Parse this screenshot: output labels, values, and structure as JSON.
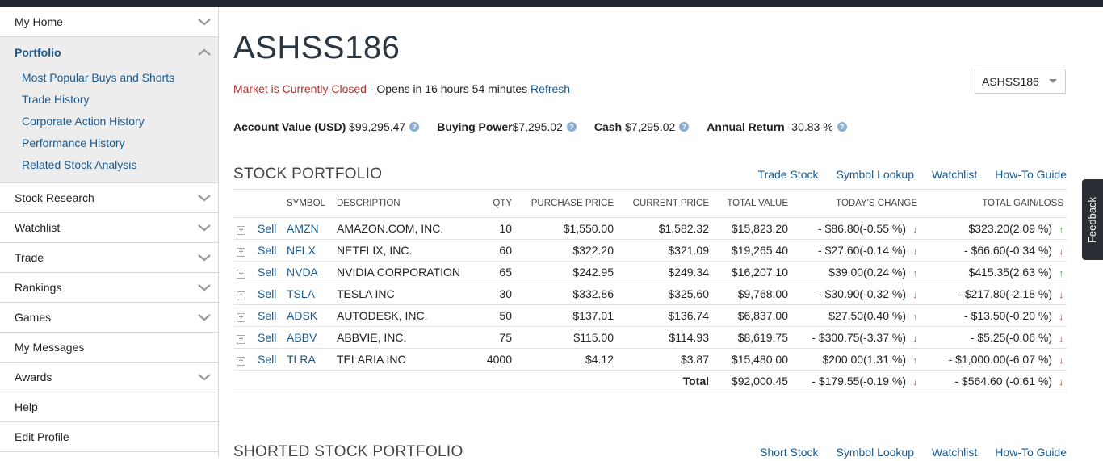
{
  "sidebar": {
    "items": [
      {
        "label": "My Home",
        "chevron": "down"
      },
      {
        "label": "Portfolio",
        "chevron": "up",
        "active": true,
        "children": [
          "Most Popular Buys and Shorts",
          "Trade History",
          "Corporate Action History",
          "Performance History",
          "Related Stock Analysis"
        ]
      },
      {
        "label": "Stock Research",
        "chevron": "down"
      },
      {
        "label": "Watchlist",
        "chevron": "down"
      },
      {
        "label": "Trade",
        "chevron": "down"
      },
      {
        "label": "Rankings",
        "chevron": "down"
      },
      {
        "label": "Games",
        "chevron": "down"
      },
      {
        "label": "My Messages",
        "chevron": ""
      },
      {
        "label": "Awards",
        "chevron": "down"
      },
      {
        "label": "Help",
        "chevron": ""
      },
      {
        "label": "Edit Profile",
        "chevron": ""
      }
    ]
  },
  "header": {
    "title": "ASHSS186",
    "market_status": "Market is Currently Closed",
    "market_opens": " - Opens in 16 hours 54 minutes ",
    "refresh": "Refresh",
    "account_select": "ASHSS186"
  },
  "stats": {
    "account_value_label": "Account Value (USD)",
    "account_value": "$99,295.47",
    "buying_power_label": "Buying Power",
    "buying_power": "$7,295.02",
    "cash_label": "Cash",
    "cash": "$7,295.02",
    "annual_return_label": "Annual Return",
    "annual_return": "-30.83 %"
  },
  "stock_portfolio": {
    "title": "STOCK PORTFOLIO",
    "links": [
      "Trade Stock",
      "Symbol Lookup",
      "Watchlist",
      "How-To Guide"
    ],
    "columns": [
      "SYMBOL",
      "DESCRIPTION",
      "QTY",
      "PURCHASE PRICE",
      "CURRENT PRICE",
      "TOTAL VALUE",
      "TODAY'S CHANGE",
      "TOTAL GAIN/LOSS"
    ],
    "sell_label": "Sell",
    "rows": [
      {
        "symbol": "AMZN",
        "desc": "AMAZON.COM, INC.",
        "qty": "10",
        "purchase": "$1,550.00",
        "current": "$1,582.32",
        "total": "$15,823.20",
        "change": "- $86.80(-0.55 %)",
        "change_dir": "down",
        "gain": "$323.20(2.09 %)",
        "gain_dir": "up"
      },
      {
        "symbol": "NFLX",
        "desc": "NETFLIX, INC.",
        "qty": "60",
        "purchase": "$322.20",
        "current": "$321.09",
        "total": "$19,265.40",
        "change": "- $27.60(-0.14 %)",
        "change_dir": "down",
        "gain": "- $66.60(-0.34 %)",
        "gain_dir": "down"
      },
      {
        "symbol": "NVDA",
        "desc": "NVIDIA CORPORATION",
        "qty": "65",
        "purchase": "$242.95",
        "current": "$249.34",
        "total": "$16,207.10",
        "change": "$39.00(0.24 %)",
        "change_dir": "up",
        "gain": "$415.35(2.63 %)",
        "gain_dir": "up"
      },
      {
        "symbol": "TSLA",
        "desc": "TESLA INC",
        "qty": "30",
        "purchase": "$332.86",
        "current": "$325.60",
        "total": "$9,768.00",
        "change": "- $30.90(-0.32 %)",
        "change_dir": "down",
        "gain": "- $217.80(-2.18 %)",
        "gain_dir": "down"
      },
      {
        "symbol": "ADSK",
        "desc": "AUTODESK, INC.",
        "qty": "50",
        "purchase": "$137.01",
        "current": "$136.74",
        "total": "$6,837.00",
        "change": "$27.50(0.40 %)",
        "change_dir": "up",
        "gain": "- $13.50(-0.20 %)",
        "gain_dir": "down"
      },
      {
        "symbol": "ABBV",
        "desc": "ABBVIE, INC.",
        "qty": "75",
        "purchase": "$115.00",
        "current": "$114.93",
        "total": "$8,619.75",
        "change": "- $300.75(-3.37 %)",
        "change_dir": "down",
        "gain": "- $5.25(-0.06 %)",
        "gain_dir": "down"
      },
      {
        "symbol": "TLRA",
        "desc": "TELARIA INC",
        "qty": "4000",
        "purchase": "$4.12",
        "current": "$3.87",
        "total": "$15,480.00",
        "change": "$200.00(1.31 %)",
        "change_dir": "up",
        "gain": "- $1,000.00(-6.07 %)",
        "gain_dir": "down"
      }
    ],
    "total": {
      "label": "Total",
      "total": "$92,000.45",
      "change": "- $179.55(-0.19 %)",
      "change_dir": "down",
      "gain": "- $564.60 (-0.61 %)",
      "gain_dir": "down"
    }
  },
  "shorted_portfolio": {
    "title": "SHORTED STOCK PORTFOLIO",
    "links": [
      "Short Stock",
      "Symbol Lookup",
      "Watchlist",
      "How-To Guide"
    ]
  },
  "feedback": "Feedback",
  "colors": {
    "positive": "#25a23e",
    "negative": "#a8352f",
    "link": "#1a5a8e"
  }
}
